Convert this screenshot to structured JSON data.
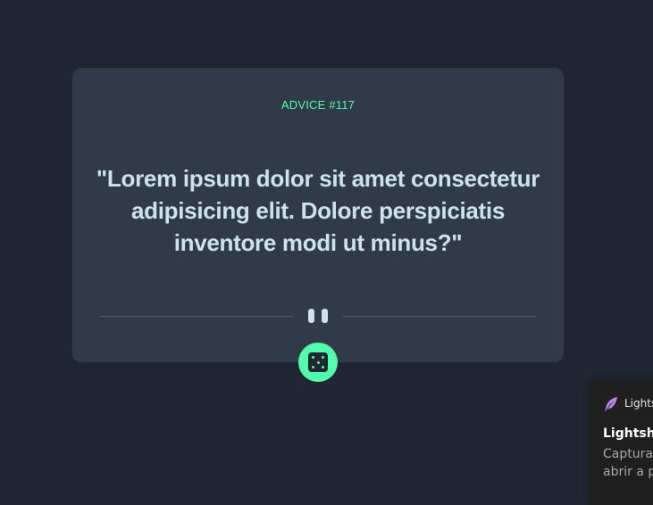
{
  "advice": {
    "id_label": "ADVICE #117",
    "quote": "\"Lorem ipsum dolor sit amet consectetur adipisicing elit. Dolore perspiciatis inventore modi ut minus?\""
  },
  "dice_button": {
    "icon": "dice-icon"
  },
  "notification": {
    "app_name": "Lightshot",
    "title": "Lightshot",
    "body_line1": "Captura",
    "body_line2": "abrir a p"
  },
  "colors": {
    "background": "#202632",
    "card": "#313a48",
    "accent": "#53ffaa",
    "text": "#cee3e9",
    "divider": "#4f5d74"
  }
}
